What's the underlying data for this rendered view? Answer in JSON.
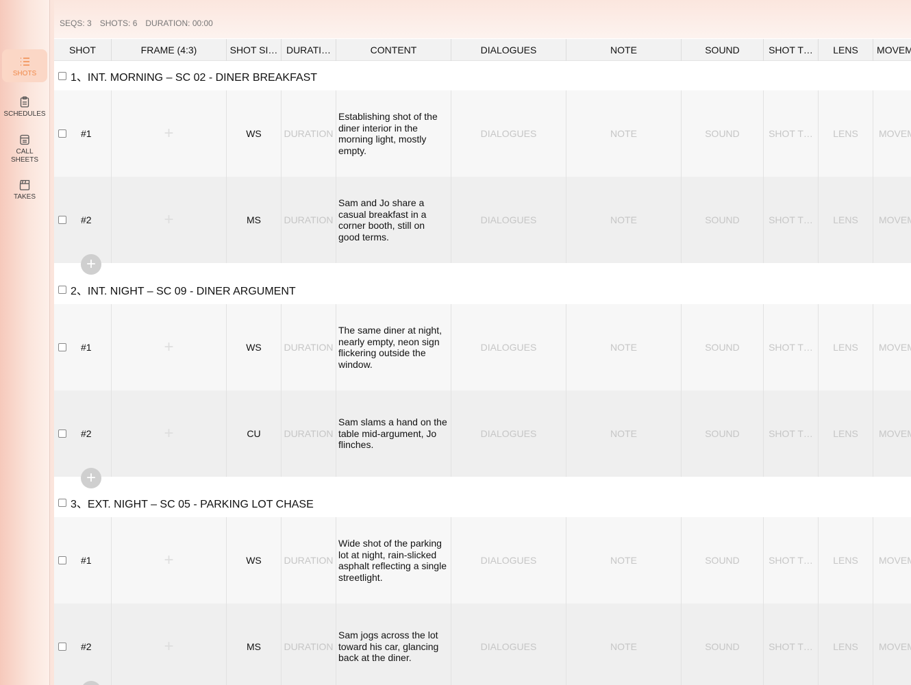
{
  "sidebar": {
    "items": [
      {
        "label": "SHOTS",
        "icon": "list-icon",
        "active": true
      },
      {
        "label": "SCHEDULES",
        "icon": "clipboard-icon",
        "active": false
      },
      {
        "label": "CALL\nSHEETS",
        "icon": "callsheet-icon",
        "active": false
      },
      {
        "label": "TAKES",
        "icon": "clapperboard-icon",
        "active": false
      }
    ]
  },
  "stats": {
    "seqs": "SEQS: 3",
    "shots": "SHOTS: 6",
    "duration": "DURATION: 00:00"
  },
  "columns": [
    "SHOT",
    "FRAME (4:3)",
    "SHOT SI…",
    "DURATI…",
    "CONTENT",
    "DIALOGUES",
    "NOTE",
    "SOUND",
    "SHOT T…",
    "LENS",
    "MOVEM"
  ],
  "placeholders": {
    "duration": "DURATION",
    "dialogues": "DIALOGUES",
    "note": "NOTE",
    "sound": "SOUND",
    "shot_type": "SHOT T…",
    "lens": "LENS",
    "movement": "MOVEM"
  },
  "frame_plus": "+",
  "add_label": "+",
  "sequences": [
    {
      "title": "1、INT. MORNING – SC 02 - DINER BREAKFAST",
      "shots": [
        {
          "num": "#1",
          "size": "WS",
          "content": "Establishing shot of the diner interior in the morning light, mostly empty."
        },
        {
          "num": "#2",
          "size": "MS",
          "content": "Sam and Jo share a casual breakfast in a corner booth, still on good terms."
        }
      ]
    },
    {
      "title": "2、INT. NIGHT – SC 09 - DINER ARGUMENT",
      "shots": [
        {
          "num": "#1",
          "size": "WS",
          "content": "The same diner at night, nearly empty, neon sign flickering outside the window."
        },
        {
          "num": "#2",
          "size": "CU",
          "content": "Sam slams a hand on the table mid-argument, Jo flinches."
        }
      ]
    },
    {
      "title": "3、EXT. NIGHT – SC 05 - PARKING LOT CHASE",
      "shots": [
        {
          "num": "#1",
          "size": "WS",
          "content": "Wide shot of the parking lot at night, rain-slicked asphalt reflecting a single streetlight."
        },
        {
          "num": "#2",
          "size": "MS",
          "content": "Sam jogs across the lot toward his car, glancing back at the diner."
        }
      ]
    }
  ]
}
